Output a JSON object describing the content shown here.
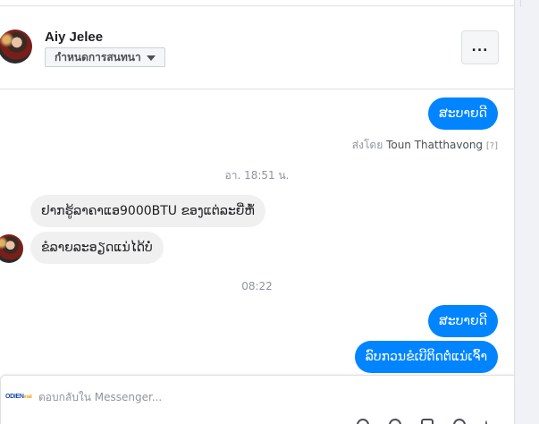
{
  "header": {
    "name": "Aiy Jelee",
    "status_label": "กำหนดการสนทนา",
    "more_label": "..."
  },
  "messages": {
    "m1": "ສະບາຍດີ",
    "sent_by_prefix": "ส่งโดย ",
    "sent_by_name": "Toun Thatthavong",
    "sent_by_help": "[?]",
    "stamp1": "อา. 18:51 น.",
    "m2": "ຢາກຮູ້ລາຄາແອ9000BTU ຂອງແຕ່ລະຍີ່ຫໍ້",
    "m3": "ຂໍລາຍລະອຽດແນ່ໄດ້ບໍ່",
    "stamp2": "08:22",
    "m4": "ສະບາຍດີ",
    "m5": "ລົບກວນຂໍເບີຕິດຕໍ່ແນ່ເຈົ້າ"
  },
  "composer": {
    "logo_text": "ODIEN",
    "logo_small": "mall",
    "placeholder": "ตอบกลับใน Messenger..."
  },
  "colors": {
    "outgoing": "#0084ff",
    "incoming": "#f1f0f0",
    "meta_text": "#90949c"
  }
}
